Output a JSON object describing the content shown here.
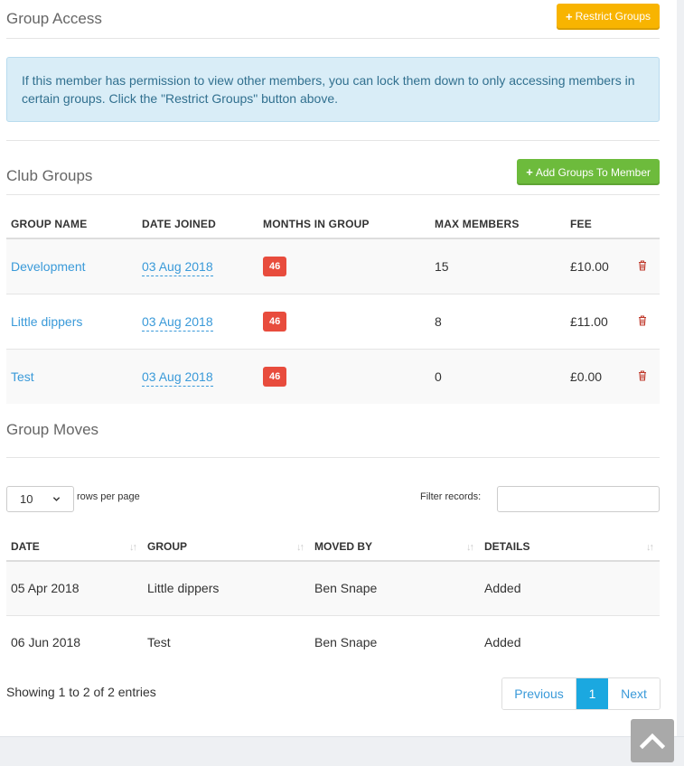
{
  "group_access": {
    "title": "Group Access",
    "restrict_button": "Restrict Groups",
    "info_text": "If this member has permission to view other members, you can lock them down to only accessing members in certain groups. Click the \"Restrict Groups\" button above."
  },
  "club_groups": {
    "title": "Club Groups",
    "add_button": "Add Groups To Member",
    "columns": [
      "GROUP NAME",
      "DATE JOINED",
      "MONTHS IN GROUP",
      "MAX MEMBERS",
      "FEE"
    ],
    "rows": [
      {
        "name": "Development",
        "date": "03 Aug 2018",
        "months": "46",
        "max": "15",
        "fee": "£10.00"
      },
      {
        "name": "Little dippers",
        "date": "03 Aug 2018",
        "months": "46",
        "max": "8",
        "fee": "£11.00"
      },
      {
        "name": "Test",
        "date": "03 Aug 2018",
        "months": "46",
        "max": "0",
        "fee": "£0.00"
      }
    ]
  },
  "group_moves": {
    "title": "Group Moves",
    "page_length": "10",
    "rows_per_page_label": "rows per page",
    "filter_label": "Filter records:",
    "filter_value": "",
    "columns": [
      "DATE",
      "GROUP",
      "MOVED BY",
      "DETAILS"
    ],
    "rows": [
      {
        "date": "05 Apr 2018",
        "group": "Little dippers",
        "moved_by": "Ben Snape",
        "details": "Added"
      },
      {
        "date": "06 Jun 2018",
        "group": "Test",
        "moved_by": "Ben Snape",
        "details": "Added"
      }
    ],
    "info": "Showing 1 to 2 of 2 entries",
    "pagination": {
      "previous": "Previous",
      "current": "1",
      "next": "Next"
    }
  },
  "icons": {
    "plus": "plus-icon",
    "delete": "trash-icon",
    "sort": "sort-icon",
    "select": "chevron-down-icon",
    "scroll_top": "chevron-up-icon"
  },
  "colors": {
    "warning": "#f8b400",
    "success": "#6dbb3c",
    "info_bg": "#d9edf7",
    "link": "#3a9ad9",
    "badge": "#e84c3d",
    "pager_active": "#1ba8e0"
  }
}
